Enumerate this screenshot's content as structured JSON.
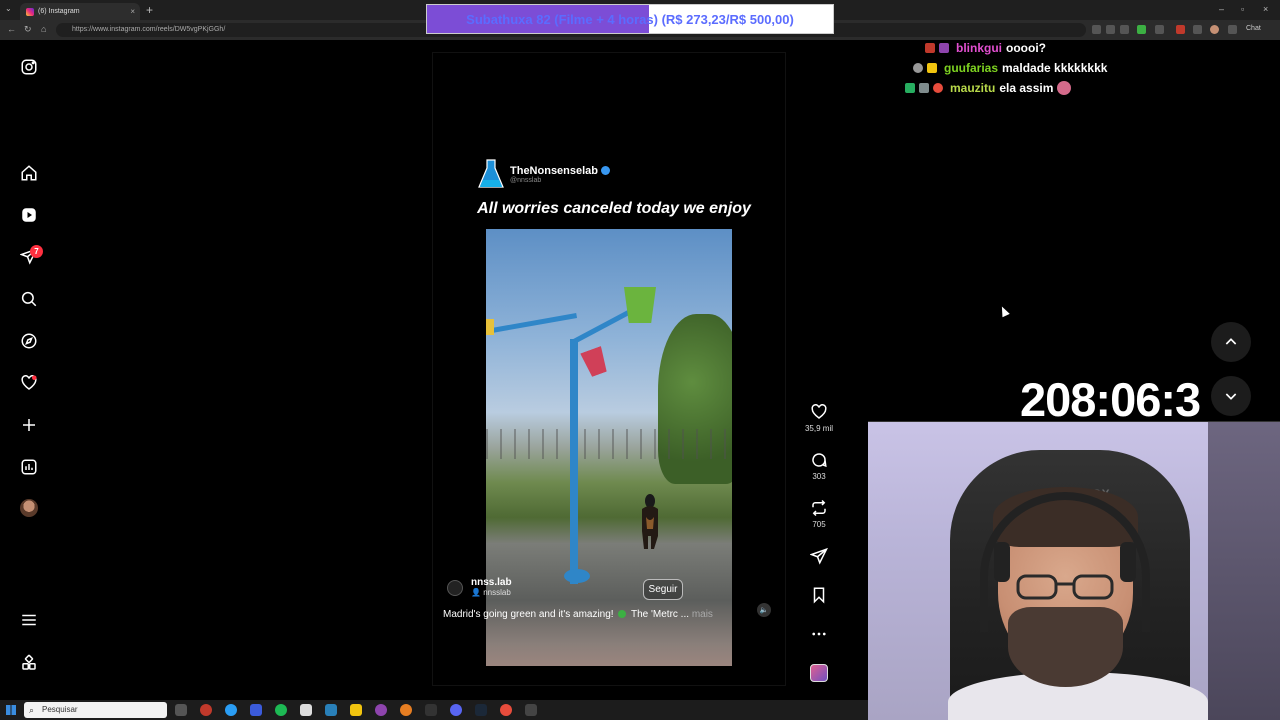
{
  "browser": {
    "tab_title": "(6) Instagram",
    "tab_close": "×",
    "new_tab": "+",
    "url": "https://www.instagram.com/reels/DW5vgPKjGGh/",
    "chat_button": "Chat",
    "window_controls": [
      "–",
      "▫",
      "×"
    ]
  },
  "goal_banner": {
    "text": "Subathuxa 82 (Filme + 4 horas) (R$ 273,23/R$ 500,00)",
    "progress": 0.546,
    "fill_color": "#7c4dd6",
    "text_color": "#5b6cff"
  },
  "sidebar": {
    "notifications_badge": "7",
    "items": [
      "instagram-logo",
      "home",
      "reels",
      "messages",
      "search",
      "explore",
      "notifications",
      "create",
      "dashboard",
      "profile",
      "more",
      "also-from-meta"
    ]
  },
  "reel": {
    "brand_name": "TheNonsenselab",
    "brand_handle": "@nnsslab",
    "headline": "All worries canceled today we enjoy",
    "author_name": "nnss.lab",
    "author_sub": "nnsslab",
    "follow_label": "Seguir",
    "caption_start": "Madrid's going green and it's amazing!",
    "caption_end": "The 'Metrc ...",
    "caption_more": "mais",
    "mute_icon": "🔈"
  },
  "actions": {
    "likes": "35,9 mil",
    "comments": "303",
    "reposts": "705"
  },
  "chat": [
    {
      "user": "blinkgui",
      "user_color": "#e24fd0",
      "message": "ooooi?",
      "badges": [
        "#c0392b",
        "#8e44ad"
      ]
    },
    {
      "user": "guufarias",
      "user_color": "#7ed321",
      "message": "maldade kkkkkkkk",
      "badges": [
        "#999999",
        "#f1c40f"
      ]
    },
    {
      "user": "mauzitu",
      "user_color": "#b8d94a",
      "message": "ela assim",
      "badges": [
        "#27ae60",
        "#7f8c8d",
        "#e74c3c"
      ]
    }
  ],
  "timer": "208:06:3",
  "taskbar": {
    "search_placeholder": "Pesquisar"
  }
}
